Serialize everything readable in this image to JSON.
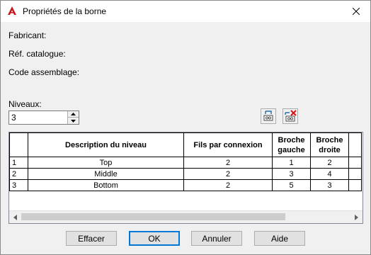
{
  "window": {
    "title": "Propriétés de la borne",
    "close_glyph": "✕"
  },
  "fields": {
    "fabricant": "Fabricant:",
    "ref_catalogue": "Réf. catalogue:",
    "code_assemblage": "Code assemblage:"
  },
  "levels": {
    "label": "Niveaux:",
    "value": "3"
  },
  "table": {
    "headers": [
      "Description du niveau",
      "Fils par connexion",
      "Broche gauche",
      "Broche droite"
    ],
    "rows": [
      {
        "num": "1",
        "description": "Top",
        "fils": "2",
        "gauche": "1",
        "droite": "2"
      },
      {
        "num": "2",
        "description": "Middle",
        "fils": "2",
        "gauche": "3",
        "droite": "4"
      },
      {
        "num": "3",
        "description": "Bottom",
        "fils": "2",
        "gauche": "5",
        "droite": "3"
      }
    ]
  },
  "buttons": {
    "effacer": "Effacer",
    "ok": "OK",
    "annuler": "Annuler",
    "aide": "Aide"
  },
  "colors": {
    "accent": "#0078d7",
    "app_icon_red": "#c4191f",
    "delete_red": "#e01010"
  },
  "icons": {
    "app": "autocad-icon",
    "insert_level": "insert-level-icon",
    "delete_level": "delete-level-icon"
  }
}
